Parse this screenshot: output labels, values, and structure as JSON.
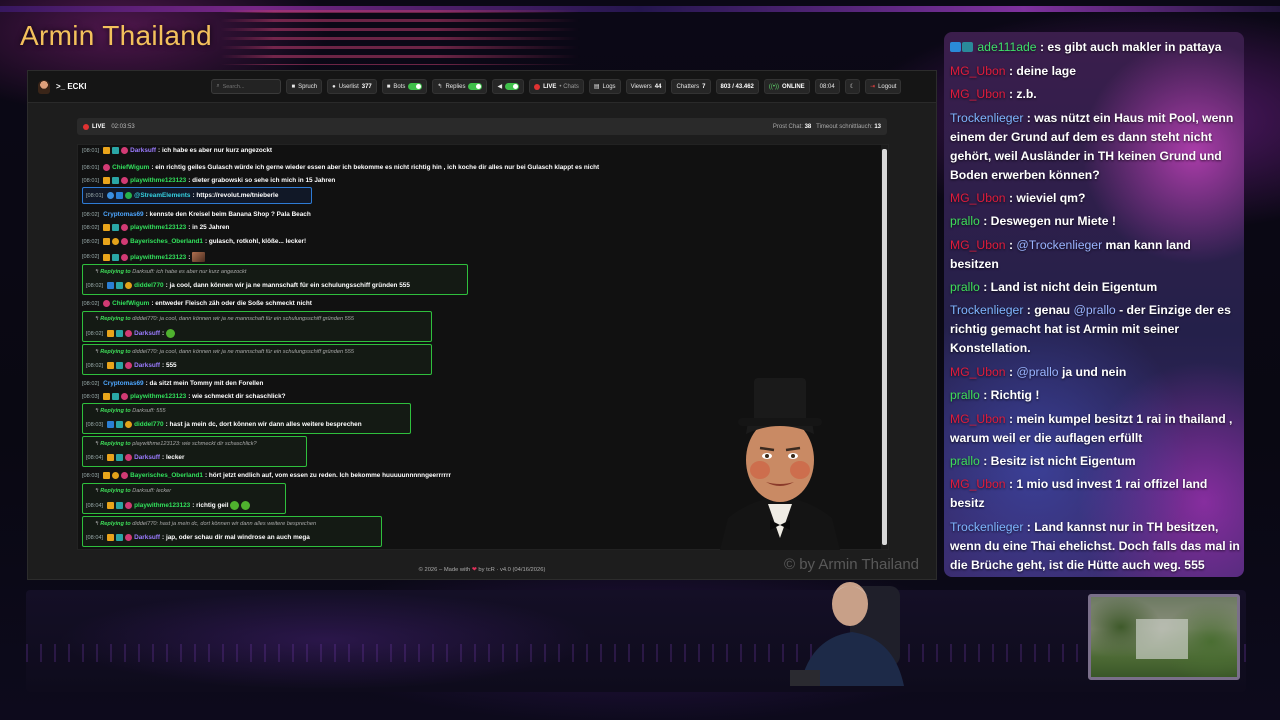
{
  "overlay": {
    "channel_title": "Armin Thailand",
    "watermark": "© by Armin Thailand"
  },
  "app": {
    "brand": ">_ ECKI",
    "search_placeholder": "Search...",
    "toolbar": {
      "spruch": "Spruch",
      "userlist_label": "Userlist",
      "userlist_count": "377",
      "bots": "Bots",
      "replies": "Replies",
      "live": "LIVE",
      "chats": "• Chats",
      "logs": "Logs",
      "viewers_label": "Viewers",
      "viewers_count": "44",
      "chatters_label": "Chatters",
      "chatters_count": "7",
      "ratio": "803 / 43.462",
      "online": "ONLINE",
      "clock": "08:04",
      "logout": "Logout"
    },
    "live_header": {
      "live": "LIVE",
      "timer": "02:03:53",
      "prost_label": "Prost Chat:",
      "prost_value": "38",
      "timeout_label": "Timeout schnittlauch:",
      "timeout_value": "13"
    },
    "footer": {
      "prefix": "© 2026 – Made with",
      "heart": "❤",
      "suffix": "by tcR · v4.0 (04/16/2026)"
    }
  },
  "chat_log": [
    {
      "time": "[08:01]",
      "user": "Darksuff",
      "text": ": ich habe es aber nur kurz angezockt"
    },
    {
      "time": "[08:01]",
      "user": "ChiefWigum",
      "text": ": ein richtig geiles Gulasch würde ich gerne wieder essen aber ich bekomme es nicht richtig hin , ich koche dir alles nur bei Gulasch klappt es nicht"
    },
    {
      "time": "[08:01]",
      "user": "playwithme123123",
      "text": ": dieter grabowski so sehe ich mich in 15 Jahren"
    },
    {
      "time": "[08:01]",
      "user": "@StreamElements",
      "text": ": https://revolut.me/tnieberle"
    },
    {
      "time": "[08:02]",
      "user": "Cryptomas69",
      "text": ": kennste den Kreisel beim Banana Shop ? Pala Beach"
    },
    {
      "time": "[08:02]",
      "user": "playwithme123123",
      "text": ": in 25 Jahren"
    },
    {
      "time": "[08:02]",
      "user": "Bayerisches_Oberland1",
      "text": ": gulasch, rotkohl, klöße... lecker!"
    },
    {
      "time": "[08:02]",
      "user": "playwithme123123",
      "text": ":"
    },
    {
      "reply_prefix": "Replying to",
      "reply_text": "Darksuff: ich habe es aber nur kurz angezockt",
      "time": "[08:02]",
      "user": "diddel770",
      "text": ": ja cool, dann können wir ja ne mannschaft für ein schulungsschiff gründen 555"
    },
    {
      "time": "[08:02]",
      "user": "ChiefWigum",
      "text": ": entweder Fleisch zäh oder die Soße schmeckt nicht"
    },
    {
      "reply_prefix": "Replying to",
      "reply_text": "diddel770: ja cool, dann können wir ja ne mannschaft für ein schulungsschiff gründen 555",
      "time": "[08:02]",
      "user": "Darksuff",
      "text": ":"
    },
    {
      "reply_prefix": "Replying to",
      "reply_text": "diddel770: ja cool, dann können wir ja ne mannschaft für ein schulungsschiff gründen 555",
      "time": "[08:02]",
      "user": "Darksuff",
      "text": ": 555"
    },
    {
      "time": "[08:02]",
      "user": "Cryptomas69",
      "text": ": da sitzt mein Tommy mit den Forellen"
    },
    {
      "time": "[08:03]",
      "user": "playwithme123123",
      "text": ": wie schmeckt dir schaschlick?"
    },
    {
      "reply_prefix": "Replying to",
      "reply_text": "Darksuff: 555",
      "time": "[08:03]",
      "user": "diddel770",
      "text": ": hast ja mein dc, dort können wir dann alles weitere besprechen"
    },
    {
      "reply_prefix": "Replying to",
      "reply_text": "playwithme123123: wie schmeckt dir schaschlick?",
      "time": "[08:04]",
      "user": "Darksuff",
      "text": ": lecker"
    },
    {
      "time": "[08:03]",
      "user": "Bayerisches_Oberland1",
      "text": ": hört jetzt endlich auf, vom essen zu reden. Ich bekomme huuuuunnnnngeerrrrrr"
    },
    {
      "reply_prefix": "Replying to",
      "reply_text": "Darksuff: lecker",
      "time": "[08:04]",
      "user": "playwithme123123",
      "text": ": richtig geil"
    },
    {
      "reply_prefix": "Replying to",
      "reply_text": "diddel770: hast ja mein dc, dort können wir dann alles weitere besprechen",
      "time": "[08:04]",
      "user": "Darksuff",
      "text": ": jap, oder schau dir mal windrose an auch mega"
    }
  ],
  "stream_chat": [
    {
      "user": "ade111ade",
      "text": ": es gibt auch makler in pattaya"
    },
    {
      "user": "MG_Ubon",
      "text": ": deine lage"
    },
    {
      "user": "MG_Ubon",
      "text": ": z.b."
    },
    {
      "user": "Trockenlieger",
      "text": ": was nützt ein Haus mit Pool, wenn einem der Grund auf dem es dann steht nicht gehört, weil Ausländer in TH keinen Grund und Boden erwerben können?"
    },
    {
      "user": "MG_Ubon",
      "text": ": wieviel qm?"
    },
    {
      "user": "prallo",
      "text": ": Deswegen nur Miete !"
    },
    {
      "user": "MG_Ubon",
      "text": ":",
      "mention": "@Trockenlieger",
      "text2": " man kann land besitzen"
    },
    {
      "user": "prallo",
      "text": ": Land ist nicht dein Eigentum"
    },
    {
      "user": "Trockenlieger",
      "text": ": genau",
      "mention": "@prallo",
      "text2": " - der Einzige der es richtig gemacht hat ist Armin mit seiner Konstellation."
    },
    {
      "user": "MG_Ubon",
      "text": ":",
      "mention": "@prallo",
      "text2": " ja und nein"
    },
    {
      "user": "prallo",
      "text": ": Richtig !"
    },
    {
      "user": "MG_Ubon",
      "text": ": mein kumpel besitzt 1 rai in thailand , warum weil er die auflagen erfüllt"
    },
    {
      "user": "prallo",
      "text": ": Besitz ist nicht Eigentum"
    },
    {
      "user": "MG_Ubon",
      "text": ": 1 mio usd invest 1 rai offizel land besitz"
    },
    {
      "user": "Trockenlieger",
      "text": ": Land kannst nur in TH besitzen, wenn du eine Thai ehelichst. Doch falls das mal in die Brüche geht, ist die Hütte auch weg. 555"
    }
  ]
}
